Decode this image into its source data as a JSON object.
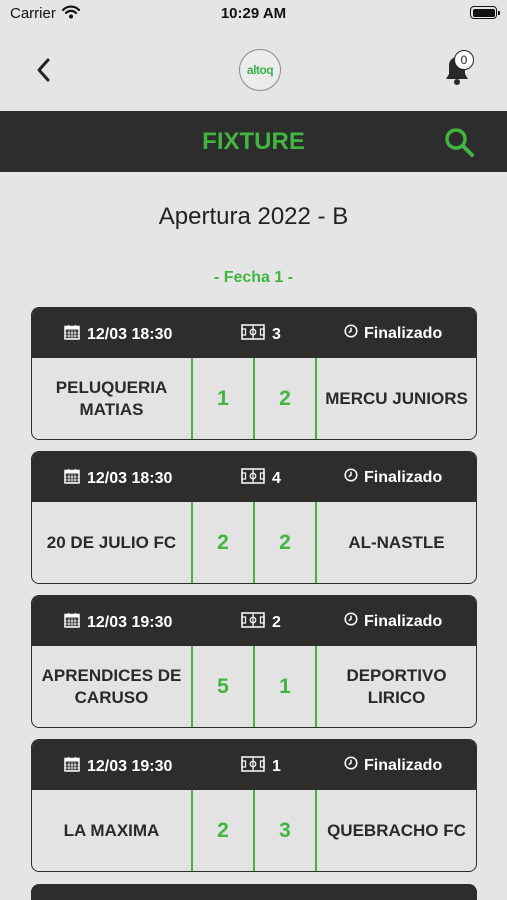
{
  "status_bar": {
    "carrier": "Carrier",
    "time": "10:29 AM"
  },
  "header": {
    "logo_text": "altoq",
    "notification_count": "0",
    "title": "FIXTURE"
  },
  "tournament": "Apertura 2022 - B",
  "round_label": "- Fecha 1 -",
  "colors": {
    "accent": "#40b53f",
    "dark": "#2d2d2d",
    "background": "#e5e5e5"
  },
  "matches": [
    {
      "datetime": "12/03 18:30",
      "field": "3",
      "status": "Finalizado",
      "home": "PELUQUERIA MATIAS",
      "home_score": "1",
      "away_score": "2",
      "away": "MERCU JUNIORS"
    },
    {
      "datetime": "12/03 18:30",
      "field": "4",
      "status": "Finalizado",
      "home": "20 DE JULIO FC",
      "home_score": "2",
      "away_score": "2",
      "away": "AL-NASTLE"
    },
    {
      "datetime": "12/03 19:30",
      "field": "2",
      "status": "Finalizado",
      "home": "APRENDICES DE CARUSO",
      "home_score": "5",
      "away_score": "1",
      "away": "DEPORTIVO LIRICO"
    },
    {
      "datetime": "12/03 19:30",
      "field": "1",
      "status": "Finalizado",
      "home": "LA MAXIMA",
      "home_score": "2",
      "away_score": "3",
      "away": "QUEBRACHO FC"
    }
  ]
}
